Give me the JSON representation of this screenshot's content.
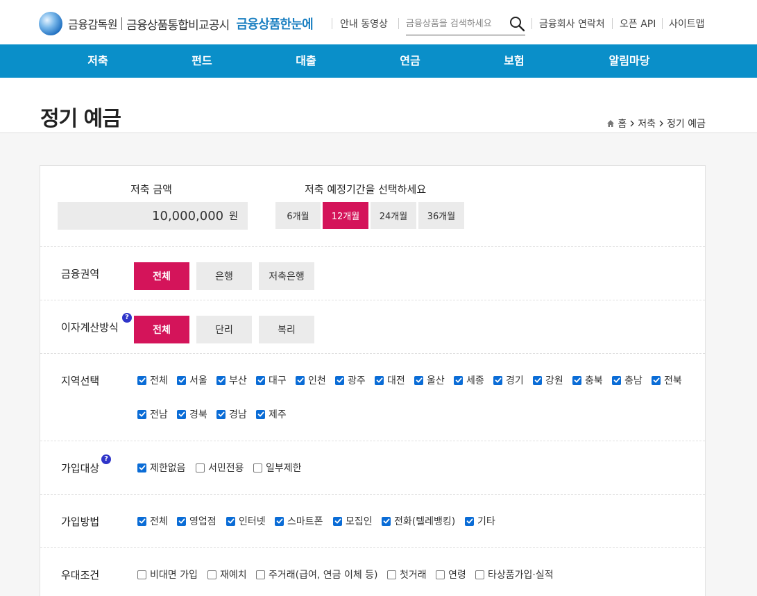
{
  "header": {
    "org_name": "금융감독원",
    "site_name": "금융상품통합비교공시",
    "brand": "금융상품한눈에",
    "guide_video": "안내 동영상",
    "search_placeholder": "금융상품을 검색하세요",
    "contacts": "금융회사 연락처",
    "open_api": "오픈 API",
    "sitemap": "사이트맵"
  },
  "nav": [
    "저축",
    "펀드",
    "대출",
    "연금",
    "보험",
    "알림마당"
  ],
  "page": {
    "title": "정기 예금",
    "breadcrumb": [
      "홈",
      "저축",
      "정기 예금"
    ]
  },
  "savings": {
    "amount_label": "저축 금액",
    "amount_value": "10,000,000",
    "amount_unit": "원",
    "period_label": "저축 예정기간을 선택하세요",
    "periods": [
      {
        "label": "6개월",
        "active": false
      },
      {
        "label": "12개월",
        "active": true
      },
      {
        "label": "24개월",
        "active": false
      },
      {
        "label": "36개월",
        "active": false
      }
    ]
  },
  "filters": {
    "sector": {
      "label": "금융권역",
      "options": [
        {
          "label": "전체",
          "active": true
        },
        {
          "label": "은행",
          "active": false
        },
        {
          "label": "저축은행",
          "active": false
        }
      ]
    },
    "interest": {
      "label": "이자계산방식",
      "help": "?",
      "options": [
        {
          "label": "전체",
          "active": true
        },
        {
          "label": "단리",
          "active": false
        },
        {
          "label": "복리",
          "active": false
        }
      ]
    },
    "region": {
      "label": "지역선택",
      "options": [
        {
          "label": "전체",
          "checked": true
        },
        {
          "label": "서울",
          "checked": true
        },
        {
          "label": "부산",
          "checked": true
        },
        {
          "label": "대구",
          "checked": true
        },
        {
          "label": "인천",
          "checked": true
        },
        {
          "label": "광주",
          "checked": true
        },
        {
          "label": "대전",
          "checked": true
        },
        {
          "label": "울산",
          "checked": true
        },
        {
          "label": "세종",
          "checked": true
        },
        {
          "label": "경기",
          "checked": true
        },
        {
          "label": "강원",
          "checked": true
        },
        {
          "label": "충북",
          "checked": true
        },
        {
          "label": "충남",
          "checked": true
        },
        {
          "label": "전북",
          "checked": true
        },
        {
          "label": "전남",
          "checked": true
        },
        {
          "label": "경북",
          "checked": true
        },
        {
          "label": "경남",
          "checked": true
        },
        {
          "label": "제주",
          "checked": true
        }
      ]
    },
    "eligibility": {
      "label": "가입대상",
      "help": "?",
      "options": [
        {
          "label": "제한없음",
          "checked": true
        },
        {
          "label": "서민전용",
          "checked": false
        },
        {
          "label": "일부제한",
          "checked": false
        }
      ]
    },
    "method": {
      "label": "가입방법",
      "options": [
        {
          "label": "전체",
          "checked": true
        },
        {
          "label": "영업점",
          "checked": true
        },
        {
          "label": "인터넷",
          "checked": true
        },
        {
          "label": "스마트폰",
          "checked": true
        },
        {
          "label": "모집인",
          "checked": true
        },
        {
          "label": "전화(텔레뱅킹)",
          "checked": true
        },
        {
          "label": "기타",
          "checked": true
        }
      ]
    },
    "preferential": {
      "label": "우대조건",
      "options": [
        {
          "label": "비대면 가입",
          "checked": false
        },
        {
          "label": "재예치",
          "checked": false
        },
        {
          "label": "주거래(급여, 연금 이체 등)",
          "checked": false
        },
        {
          "label": "첫거래",
          "checked": false
        },
        {
          "label": "연령",
          "checked": false
        },
        {
          "label": "타상품가입·실적",
          "checked": false
        }
      ]
    }
  }
}
